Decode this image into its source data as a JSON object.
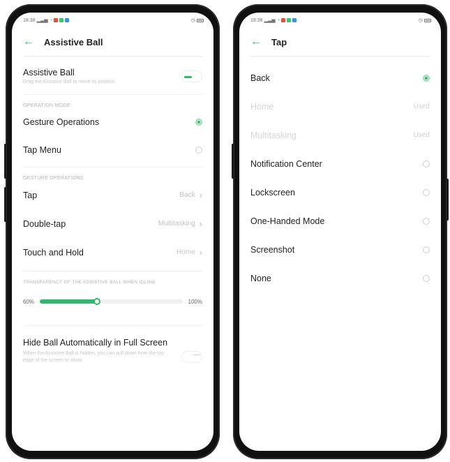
{
  "colors": {
    "accent": "#2fb96b",
    "frame": "#101010"
  },
  "left_screen": {
    "status": {
      "time": "18:38",
      "right": ""
    },
    "title": "Assistive Ball",
    "assistive_ball": {
      "label": "Assistive Ball",
      "subtitle": "Drag the Assistive Ball to move its position",
      "toggle_on": true
    },
    "operation_mode": {
      "header": "OPERATION MODE",
      "options": [
        {
          "label": "Gesture Operations",
          "selected": true
        },
        {
          "label": "Tap Menu",
          "selected": false
        }
      ]
    },
    "gesture_operations": {
      "header": "GESTURE OPERATIONS",
      "items": [
        {
          "label": "Tap",
          "value": "Back"
        },
        {
          "label": "Double-tap",
          "value": "Multitasking"
        },
        {
          "label": "Touch and Hold",
          "value": "Home"
        }
      ]
    },
    "transparency": {
      "header": "TRANSPARENCY OF THE ASSISTIVE BALL WHEN IDLING",
      "min_label": "60%",
      "max_label": "100%",
      "level": 0.4
    },
    "hide_ball": {
      "label": "Hide Ball Automatically in Full Screen",
      "subtitle": "When the Assistive Ball is hidden, you can pull down from the top edge of the screen to show",
      "toggle_on": false
    }
  },
  "right_screen": {
    "status": {
      "time": "18:38"
    },
    "title": "Tap",
    "options": [
      {
        "label": "Back",
        "value": "",
        "selected": true,
        "disabled": false
      },
      {
        "label": "Home",
        "value": "Used",
        "selected": false,
        "disabled": true
      },
      {
        "label": "Multitasking",
        "value": "Used",
        "selected": false,
        "disabled": true
      },
      {
        "label": "Notification Center",
        "value": "",
        "selected": false,
        "disabled": false
      },
      {
        "label": "Lockscreen",
        "value": "",
        "selected": false,
        "disabled": false
      },
      {
        "label": "One-Handed Mode",
        "value": "",
        "selected": false,
        "disabled": false
      },
      {
        "label": "Screenshot",
        "value": "",
        "selected": false,
        "disabled": false
      },
      {
        "label": "None",
        "value": "",
        "selected": false,
        "disabled": false
      }
    ]
  }
}
